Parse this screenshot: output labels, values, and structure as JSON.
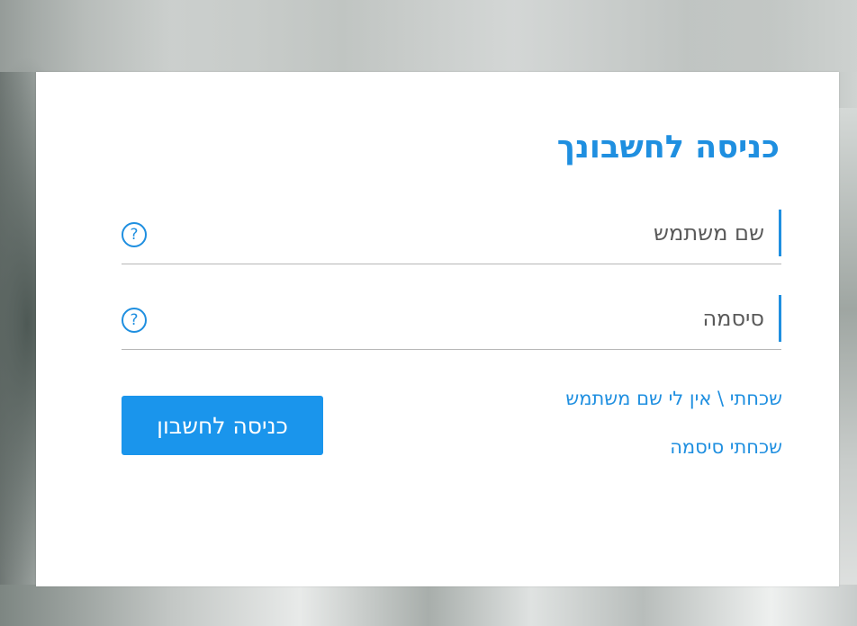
{
  "login": {
    "title": "כניסה לחשבונך",
    "username": {
      "placeholder": "שם משתמש",
      "value": "",
      "help_icon": "?"
    },
    "password": {
      "placeholder": "סיסמה",
      "value": "",
      "help_icon": "?"
    },
    "forgot_username_link": "שכחתי \\ אין לי שם משתמש",
    "forgot_password_link": "שכחתי סיסמה",
    "submit_label": "כניסה לחשבון"
  },
  "colors": {
    "accent": "#1f8fe0",
    "button": "#1a95ec",
    "card": "#ffffff"
  },
  "icons": {
    "help": "question-circle-icon"
  }
}
